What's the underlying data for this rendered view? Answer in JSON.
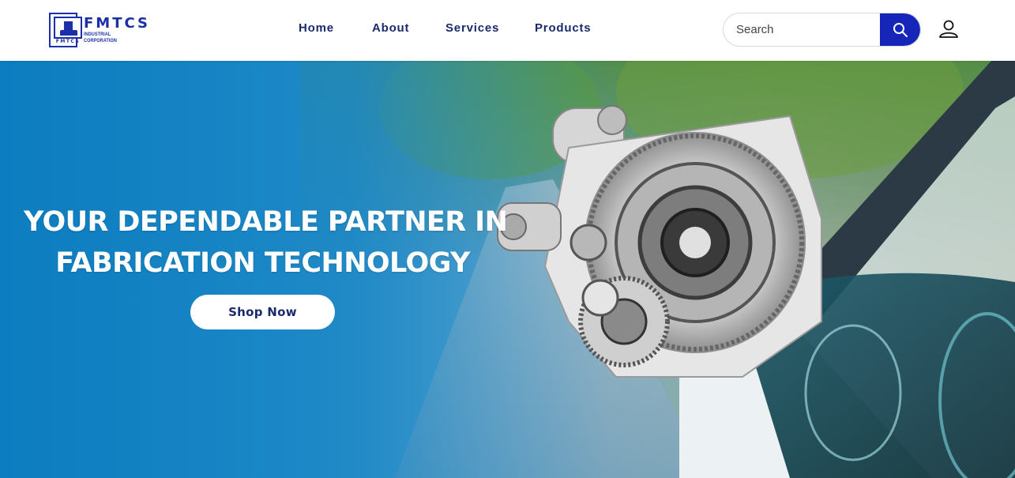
{
  "brand": {
    "name": "FMTCS",
    "subtitle": "INDUSTRIAL CORPORATION",
    "mark_text": "FMTCS"
  },
  "nav": {
    "items": [
      {
        "label": "Home"
      },
      {
        "label": "About"
      },
      {
        "label": "Services"
      },
      {
        "label": "Products"
      }
    ]
  },
  "search": {
    "placeholder": "Search",
    "button_icon": "search-icon"
  },
  "account": {
    "icon": "user-icon"
  },
  "hero": {
    "title_line1": "YOUR DEPENDABLE PARTNER IN",
    "title_line2": "FABRICATION TECHNOLOGY",
    "cta_label": "Shop Now",
    "image": "gearbox-over-road-car-interior"
  },
  "colors": {
    "brand_blue": "#1b2fa8",
    "nav_text": "#1b2a6b",
    "search_button": "#1526b8",
    "hero_blue": "#0c7dc0"
  }
}
